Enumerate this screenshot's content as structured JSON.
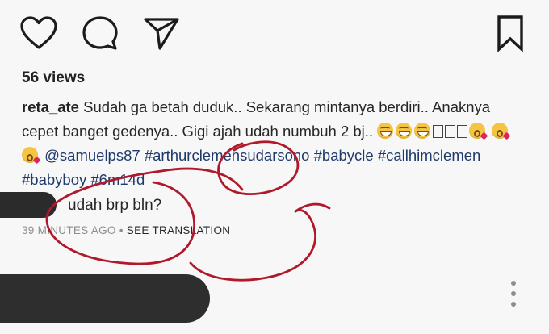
{
  "actions": {
    "like_icon": "heart-outline",
    "comment_icon": "speech-bubble-outline",
    "share_icon": "paper-plane-outline",
    "save_icon": "bookmark-outline"
  },
  "post": {
    "views": "56 views",
    "username": "reta_ate",
    "caption_text": "Sudah ga betah duduk.. Sekarang mintanya berdiri.. Anaknya cepet banget gedenya.. Gigi ajah udah numbuh 2 bj..",
    "mention": "@samuelps87",
    "hashtags": [
      "#arthurclemensudarsono",
      "#babycle",
      "#callhimclemen",
      "#babyboy",
      "#6m14d"
    ]
  },
  "comment": {
    "text": "udah brp bln?",
    "time": "39 MINUTES AGO",
    "separator": "•",
    "translate_label": "SEE TRANSLATION"
  },
  "colors": {
    "background": "#f7f7f7",
    "text": "#262626",
    "hashtag": "#1d3a6b",
    "meta": "#8e8e8e",
    "annotation": "#b0182b",
    "redaction": "#2b2b2b"
  }
}
